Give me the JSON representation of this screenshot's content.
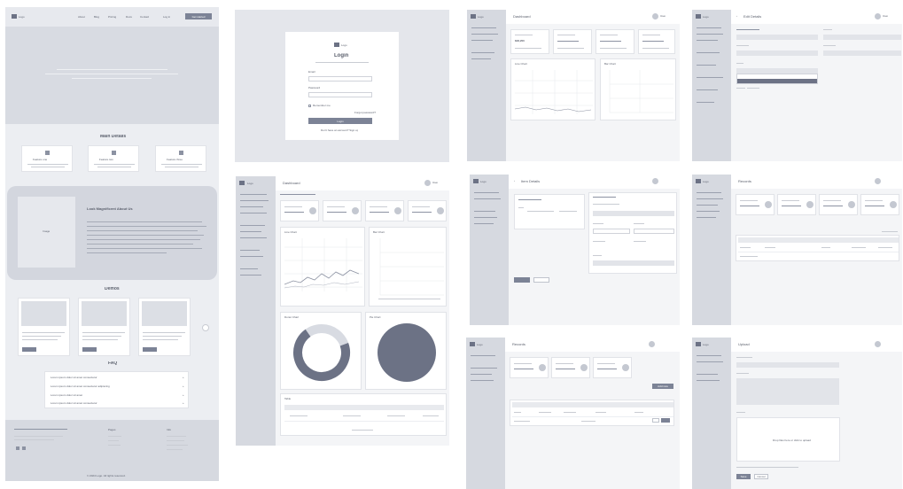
{
  "brand": {
    "name": "Logo"
  },
  "landing": {
    "nav": [
      "About",
      "Blog",
      "Pricing",
      "Docs",
      "Contact"
    ],
    "login_link": "Log in",
    "cta": "Get started",
    "features_title": "Main Details",
    "feature_cards": [
      {
        "title": "Feature one"
      },
      {
        "title": "Feature two"
      },
      {
        "title": "Feature three"
      }
    ],
    "about_title": "Look Magnificent About Us",
    "image_label": "Image",
    "gallery_title": "Demos",
    "faq_title": "FAQ",
    "faq_items": [
      "Lorem ipsum dolor sit amet consectetur",
      "Lorem ipsum dolor sit amet consectetur adipiscing",
      "Lorem ipsum dolor sit amet",
      "Lorem ipsum dolor sit amet consectetur"
    ],
    "footer_cols": [
      "Pages",
      "Info"
    ],
    "copyright": "© 2024 Logo. All rights reserved."
  },
  "login": {
    "title": "Login",
    "email_label": "Email",
    "password_label": "Password",
    "remember": "Remember me",
    "forgot": "Forgot password?",
    "submit": "Login",
    "signup": "Don't have an account? Sign up"
  },
  "dashboard": {
    "title": "Dashboard",
    "user": "User",
    "stat_value": "$48,200",
    "chart_titles": [
      "Line Chart",
      "Bar Chart",
      "Donut Chart",
      "Pie Chart"
    ],
    "table_title": "Table"
  },
  "form_page": {
    "title": "Edit Details",
    "user": "User"
  },
  "detail_page": {
    "title": "Item Details"
  },
  "list_page": {
    "title": "Records",
    "add": "Add new"
  },
  "upload_page": {
    "title": "Upload",
    "drop_text": "Drop files here or click to upload",
    "save": "Save",
    "cancel": "Cancel"
  },
  "colors": {
    "accent": "#6c7285",
    "panel": "#f4f5f7",
    "sidebar": "#d6d9e0"
  }
}
